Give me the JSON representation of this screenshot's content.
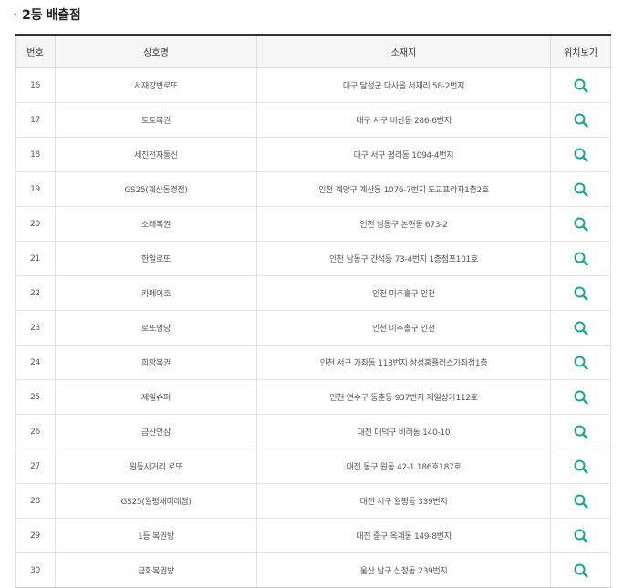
{
  "section": {
    "bullet": "·",
    "title": "2등 배출점"
  },
  "table": {
    "headers": {
      "number": "번호",
      "name": "상호명",
      "address": "소재지",
      "location": "위치보기"
    },
    "rows": [
      {
        "number": "16",
        "name": "서재강변로또",
        "address": "대구 달성군 다사읍 서재리 58-2번지"
      },
      {
        "number": "17",
        "name": "토토복권",
        "address": "대구 서구 비산동 286-6번지"
      },
      {
        "number": "18",
        "name": "세진전자통신",
        "address": "대구 서구 평리동 1094-4번지"
      },
      {
        "number": "19",
        "name": "GS25(계산동경점)",
        "address": "인천 계양구 계산동 1076-7번지 도교프라자1층2호"
      },
      {
        "number": "20",
        "name": "소래복권",
        "address": "인천 남동구 논현동 673-2"
      },
      {
        "number": "21",
        "name": "한일로또",
        "address": "인천 남동구 간석동 73-4번지 1층점포101호"
      },
      {
        "number": "22",
        "name": "카페이호",
        "address": "인천 미추홀구 인천"
      },
      {
        "number": "23",
        "name": "로또명당",
        "address": "인천 미추홀구 인천"
      },
      {
        "number": "24",
        "name": "희망복권",
        "address": "인천 서구 가좌동 118번지 삼성홈플러스가좌점1층"
      },
      {
        "number": "25",
        "name": "제일슈퍼",
        "address": "인천 연수구 동춘동 937번지 제일상가112호"
      },
      {
        "number": "26",
        "name": "금산인삼",
        "address": "대전 대덕구 비래동 140-10"
      },
      {
        "number": "27",
        "name": "원동사거리 로또",
        "address": "대전 동구 원동 42-1 186호187호"
      },
      {
        "number": "28",
        "name": "GS25(월평새미래점)",
        "address": "대전 서구 월평동 339번지"
      },
      {
        "number": "29",
        "name": "1등 복권방",
        "address": "대전 중구 옥계동 149-8번지"
      },
      {
        "number": "30",
        "name": "금화복권방",
        "address": "울산 남구 신정동 239번지"
      }
    ]
  },
  "icons": {
    "view": "search-icon"
  },
  "colors": {
    "icon": "#1fa38a",
    "header_bg": "#f5f5f5",
    "top_border": "#333333"
  }
}
